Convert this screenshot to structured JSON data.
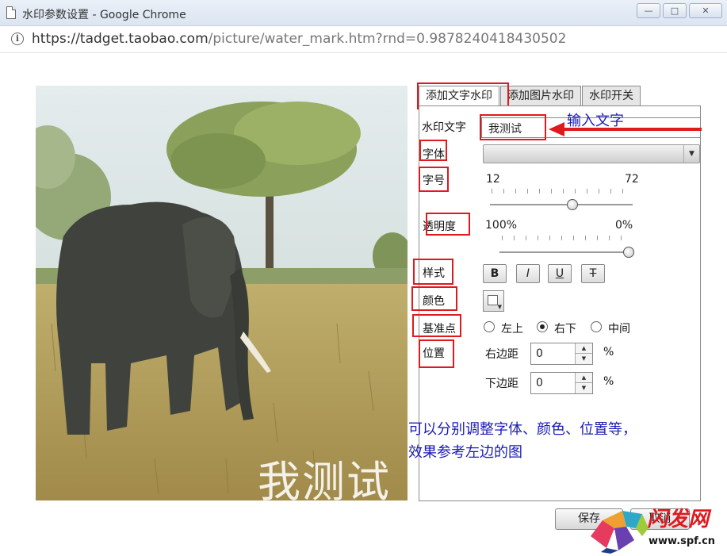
{
  "window": {
    "title": "水印参数设置 - Google Chrome",
    "url_host": "https://tadget.taobao.com",
    "url_rest": "/picture/water_mark.htm?rnd=0.9878240418430502",
    "min_glyph": "—",
    "max_glyph": "□",
    "close_glyph": "✕"
  },
  "preview": {
    "watermark_text": "我测试"
  },
  "tabs": [
    {
      "label": "添加文字水印",
      "active": true
    },
    {
      "label": "添加图片水印",
      "active": false
    },
    {
      "label": "水印开关",
      "active": false
    }
  ],
  "form": {
    "text_label": "水印文字",
    "text_value": "我测试",
    "font_label": "字体",
    "size_label": "字号",
    "size_min": "12",
    "size_max": "72",
    "size_value_fraction": 0.58,
    "opacity_label": "透明度",
    "opacity_left": "100%",
    "opacity_right": "0%",
    "opacity_value_fraction": 1.0,
    "style_label": "样式",
    "style_buttons": [
      "B",
      "I",
      "U",
      "T"
    ],
    "color_label": "颜色",
    "color_value": "#ffffff",
    "anchor_label": "基准点",
    "anchor_options": [
      {
        "label": "左上",
        "selected": false
      },
      {
        "label": "右下",
        "selected": true
      },
      {
        "label": "中间",
        "selected": false
      }
    ],
    "position_label": "位置",
    "right_margin_label": "右边距",
    "right_margin_value": "0",
    "bottom_margin_label": "下边距",
    "bottom_margin_value": "0",
    "percent": "%"
  },
  "annotations": {
    "input_hint": "输入文字",
    "note_line1": "可以分别调整字体、颜色、位置等，",
    "note_line2": "效果参考左边的图"
  },
  "buttons": {
    "save": "保存",
    "cancel": "取消"
  },
  "watermark_logo": {
    "text": "闪发网",
    "url": "www.spf.cn"
  },
  "colors": {
    "highlight": "#e0191f",
    "annotation": "#1a1ab5",
    "arrow": "#e0191f"
  }
}
